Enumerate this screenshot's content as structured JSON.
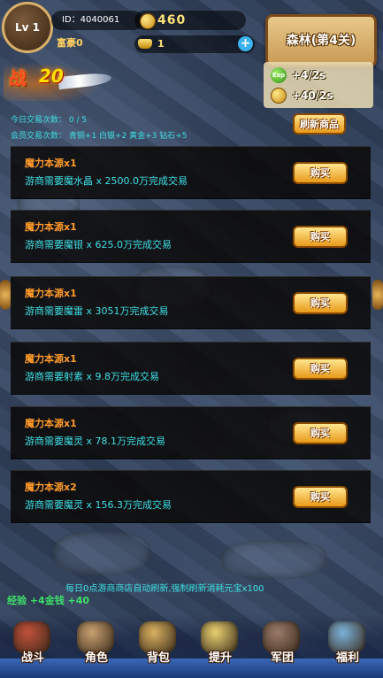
{
  "player": {
    "level_label": "Lv 1",
    "id_label": "ID：4040061",
    "gold": "460",
    "rich_label": "富豪0",
    "ingot": "1",
    "power_char": "战",
    "power_value": "20"
  },
  "map": {
    "title": "森林(第4关)",
    "exp_rate": "+4/2s",
    "gold_rate": "+40/2s",
    "exp_icon_text": "Exp"
  },
  "shop": {
    "refresh_label": "刷新商品",
    "daily_trades": "今日交易次数： 0 / 5",
    "member_trades": "会员交易次数： 青铜+1 白银+2 黄金+3 钻石+5",
    "buy_label": "购买",
    "items": [
      {
        "title": "魔力本源x1",
        "desc": "游商需要魔水晶 x 2500.0万完成交易"
      },
      {
        "title": "魔力本源x1",
        "desc": "游商需要魔银 x 625.0万完成交易"
      },
      {
        "title": "魔力本源x1",
        "desc": "游商需要魔雷 x 3051万完成交易"
      },
      {
        "title": "魔力本源x1",
        "desc": "游商需要射素 x 9.8万完成交易"
      },
      {
        "title": "魔力本源x1",
        "desc": "游商需要魔灵 x 78.1万完成交易"
      },
      {
        "title": "魔力本源x2",
        "desc": "游商需要魔灵 x 156.3万完成交易"
      }
    ],
    "notice": "每日0点游商商店自动刷新,强制刷新消耗元宝x100",
    "reward": "经验 +4金钱 +40"
  },
  "nav": [
    {
      "label": "战斗",
      "icon": "battle-icon",
      "color": "#c0503a"
    },
    {
      "label": "角色",
      "icon": "character-icon",
      "color": "#c8a070"
    },
    {
      "label": "背包",
      "icon": "bag-icon",
      "color": "#d8b060"
    },
    {
      "label": "提升",
      "icon": "upgrade-icon",
      "color": "#e8d070"
    },
    {
      "label": "军团",
      "icon": "legion-icon",
      "color": "#9a7a6a"
    },
    {
      "label": "福利",
      "icon": "welfare-icon",
      "color": "#7ab0d8"
    }
  ],
  "colors": {
    "accent_text": "#3ee0e6",
    "item_title": "#ff9a2a",
    "button_gold": "#e89a1a"
  }
}
